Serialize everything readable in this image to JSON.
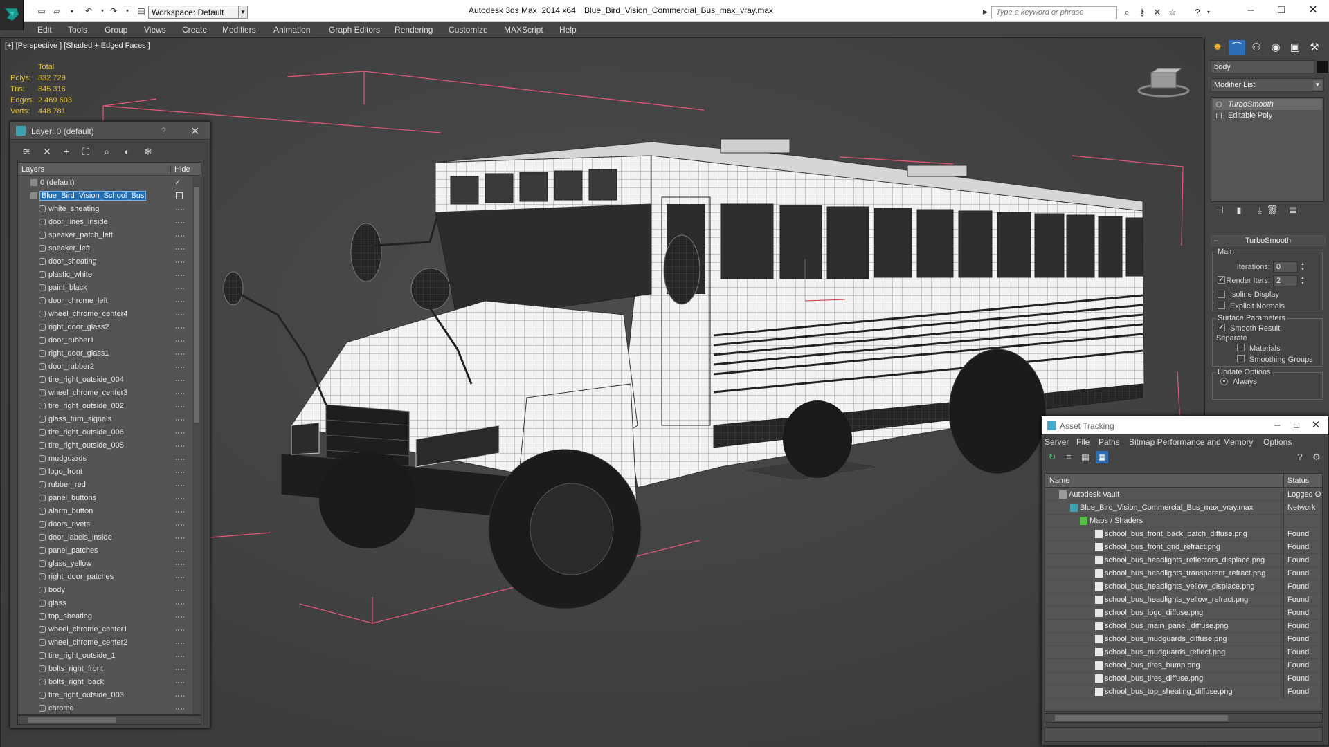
{
  "titlebar": {
    "workspace": "Workspace: Default",
    "app_title": "Autodesk 3ds Max  2014 x64",
    "file_name": "Blue_Bird_Vision_Commercial_Bus_max_vray.max",
    "search_placeholder": "Type a keyword or phrase"
  },
  "menu": [
    "Edit",
    "Tools",
    "Group",
    "Views",
    "Create",
    "Modifiers",
    "Animation",
    "Graph Editors",
    "Rendering",
    "Customize",
    "MAXScript",
    "Help"
  ],
  "viewport": {
    "label": "[+] [Perspective ] [Shaded + Edged Faces ]",
    "stats": {
      "header": "Total",
      "rows": [
        {
          "label": "Polys:",
          "value": "832 729"
        },
        {
          "label": "Tris:",
          "value": "845 316"
        },
        {
          "label": "Edges:",
          "value": "2 469 603"
        },
        {
          "label": "Verts:",
          "value": "448 781"
        }
      ]
    }
  },
  "layer_panel": {
    "title": "Layer: 0 (default)",
    "help": "?",
    "col_layers": "Layers",
    "col_hide": "Hide",
    "rows": [
      "0 (default)",
      "Blue_Bird_Vision_School_Bus",
      "white_sheating",
      "door_lines_inside",
      "speaker_patch_left",
      "speaker_left",
      "door_sheating",
      "plastic_white",
      "paint_black",
      "door_chrome_left",
      "wheel_chrome_center4",
      "right_door_glass2",
      "door_rubber1",
      "right_door_glass1",
      "door_rubber2",
      "tire_right_outside_004",
      "wheel_chrome_center3",
      "tire_right_outside_002",
      "glass_turn_signals",
      "tire_right_outside_006",
      "tire_right_outside_005",
      "mudguards",
      "logo_front",
      "rubber_red",
      "panel_buttons",
      "alarm_button",
      "doors_rivets",
      "door_labels_inside",
      "panel_patches",
      "glass_yellow",
      "right_door_patches",
      "body",
      "glass",
      "top_sheating",
      "wheel_chrome_center1",
      "wheel_chrome_center2",
      "tire_right_outside_1",
      "bolts_right_front",
      "bolts_right_back",
      "tire_right_outside_003",
      "chrome"
    ]
  },
  "command_panel": {
    "object_name": "body",
    "modifier_list": "Modifier List",
    "stack": [
      "TurboSmooth",
      "Editable Poly"
    ],
    "rollout_title": "TurboSmooth",
    "main_group": "Main",
    "iterations_label": "Iterations:",
    "iterations_value": "0",
    "render_iters_label": "Render Iters:",
    "render_iters_value": "2",
    "isoline": "Isoline Display",
    "explicit_normals": "Explicit Normals",
    "surface_group": "Surface Parameters",
    "smooth_result": "Smooth Result",
    "separate": "Separate",
    "materials": "Materials",
    "smoothing_groups": "Smoothing Groups",
    "update_group": "Update Options",
    "always": "Always"
  },
  "asset_tracking": {
    "title": "Asset Tracking",
    "menu": [
      "Server",
      "File",
      "Paths",
      "Bitmap Performance and Memory",
      "Options"
    ],
    "col_name": "Name",
    "col_status": "Status",
    "rows": [
      {
        "name": "Autodesk Vault",
        "status": "Logged O"
      },
      {
        "name": "Blue_Bird_Vision_Commercial_Bus_max_vray.max",
        "status": "Network"
      },
      {
        "name": "Maps / Shaders",
        "status": ""
      },
      {
        "name": "school_bus_front_back_patch_diffuse.png",
        "status": "Found"
      },
      {
        "name": "school_bus_front_grid_refract.png",
        "status": "Found"
      },
      {
        "name": "school_bus_headlights_reflectors_displace.png",
        "status": "Found"
      },
      {
        "name": "school_bus_headlights_transparent_refract.png",
        "status": "Found"
      },
      {
        "name": "school_bus_headlights_yellow_displace.png",
        "status": "Found"
      },
      {
        "name": "school_bus_headlights_yellow_refract.png",
        "status": "Found"
      },
      {
        "name": "school_bus_logo_diffuse.png",
        "status": "Found"
      },
      {
        "name": "school_bus_main_panel_diffuse.png",
        "status": "Found"
      },
      {
        "name": "school_bus_mudguards_diffuse.png",
        "status": "Found"
      },
      {
        "name": "school_bus_mudguards_reflect.png",
        "status": "Found"
      },
      {
        "name": "school_bus_tires_bump.png",
        "status": "Found"
      },
      {
        "name": "school_bus_tires_diffuse.png",
        "status": "Found"
      },
      {
        "name": "school_bus_top_sheating_diffuse.png",
        "status": "Found"
      }
    ]
  },
  "colors": {
    "selection": "#1f6db5",
    "stats_text": "#e3c22a",
    "bounding_box": "#e8587a"
  }
}
